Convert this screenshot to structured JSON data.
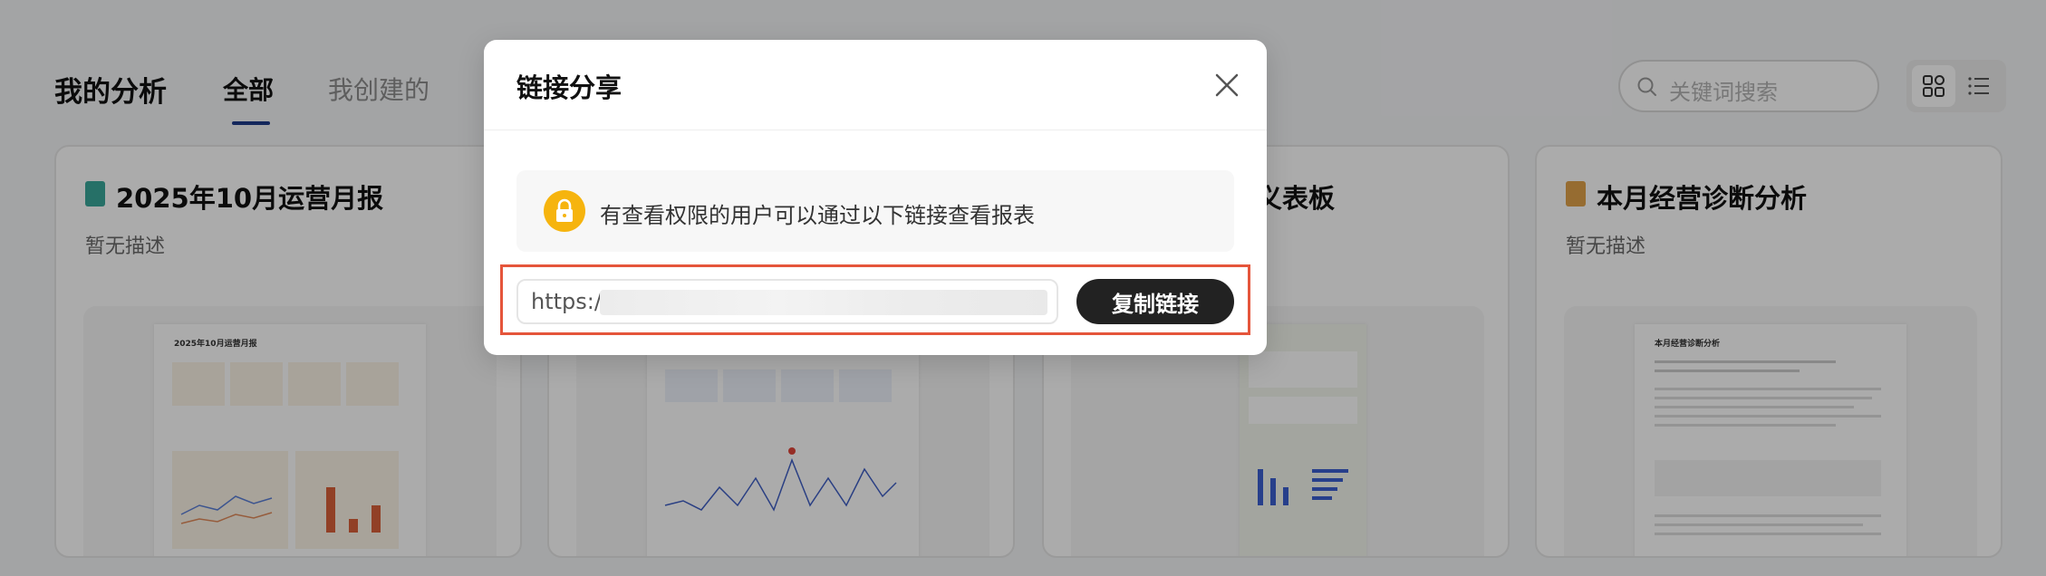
{
  "page": {
    "title": "我的分析",
    "tabs": [
      {
        "label": "全部"
      },
      {
        "label": "我创建的"
      }
    ],
    "search_placeholder": "关键词搜索"
  },
  "cards": [
    {
      "title": "2025年10月运营月报",
      "desc": "暂无描述",
      "icon_color": "#3aa89a",
      "thumb_title": "2025年10月运营月报"
    },
    {
      "title": "",
      "desc": "",
      "icon_color": "#4a7bd6",
      "thumb_title": ""
    },
    {
      "title": "义表板",
      "desc": "",
      "icon_color": "#d68a2f",
      "thumb_title": ""
    },
    {
      "title": "本月经营诊断分析",
      "desc": "暂无描述",
      "icon_color": "#e0a24a",
      "thumb_title": "本月经营诊断分析"
    }
  ],
  "modal": {
    "title": "链接分享",
    "notice": "有查看权限的用户可以通过以下链接查看报表",
    "link_prefix": "https:/",
    "copy_label": "复制链接"
  },
  "colors": {
    "accent": "#1f3b8a",
    "lock": "#f6b40e",
    "highlight": "#e5553b",
    "button": "#222222"
  }
}
